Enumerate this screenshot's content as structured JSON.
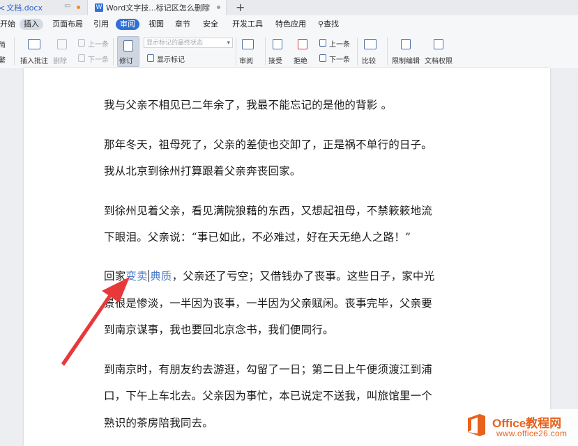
{
  "tabs": [
    {
      "label": "文档.docx",
      "prefix": "<"
    },
    {
      "label": "Word文字技...标记区怎么删除",
      "icon": "W"
    }
  ],
  "new_tab_glyph": "+",
  "menu": [
    "开始",
    "插入",
    "页面布局",
    "引用",
    "审阅",
    "视图",
    "章节",
    "安全",
    "开发工具",
    "特色应用"
  ],
  "search_label": "查找",
  "ribbon": {
    "left_partial_top": "简",
    "left_partial_bottom": "繁",
    "insert_comment": "插入批注",
    "delete": "删除",
    "prev": "上一条",
    "next": "下一条",
    "revise": "修订",
    "markup_state": "显示标记的最终状态",
    "show_markup": "显示标记",
    "review": "审阅",
    "accept": "接受",
    "reject": "拒绝",
    "prev2": "上一条",
    "next2": "下一条",
    "compare": "比较",
    "restrict_edit": "限制编辑",
    "doc_permission": "文档权限"
  },
  "document": {
    "p1": "我与父亲不相见已二年余了，我最不能忘记的是他的背影 。",
    "p2a": "那年冬天，祖母死了，父亲的差使也交卸了，正是祸不单行的日子。",
    "p2b": "我从北京到徐州打算跟着父亲奔丧回家。",
    "p3a": "到徐州见着父亲，看见满院狼藉的东西，又想起祖母，不禁簌簌地流",
    "p3b": "下眼泪。父亲说：“事已如此，不必难过，好在天无绝人之路！”",
    "p4a_pre": "回家",
    "p4a_del": "变卖",
    "p4a_ins": "典质",
    "p4a_post": "，父亲还了亏空；又借钱办了丧事。这些日子，家中光",
    "p4b": "景很是惨淡，一半因为丧事，一半因为父亲赋闲。丧事完毕，父亲要",
    "p4c": "到南京谋事，我也要回北京念书，我们便同行。",
    "p5a": "到南京时，有朋友约去游逛，勾留了一日；第二日上午便须渡江到浦",
    "p5b": "口，下午上车北去。父亲因为事忙，本已说定不送我，叫旅馆里一个",
    "p5c": "熟识的茶房陪我同去。"
  },
  "watermark": {
    "title": "Office教程网",
    "url": "www.office26.com"
  },
  "colors": {
    "accent": "#2f6fd6",
    "revision": "#4a78c6",
    "arrow": "#e8393a",
    "brand": "#e8621c"
  }
}
